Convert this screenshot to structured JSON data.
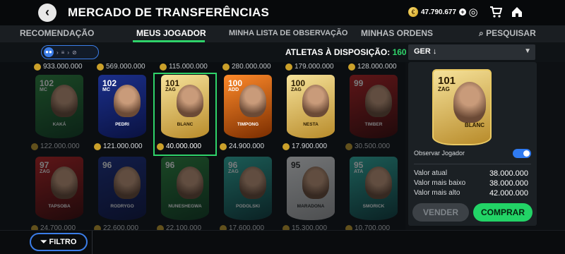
{
  "header": {
    "back_icon": "chevron-left-icon",
    "title": "MERCADO DE TRANSFERÊNCIAS",
    "coins": "47.790.677",
    "coin_symbol": "€",
    "plus": "+"
  },
  "tabs": [
    {
      "label": "RECOMENDAÇÃO",
      "active": false
    },
    {
      "label": "MEUS JOGADOR",
      "active": true
    },
    {
      "label": "MINHA LISTA DE OBSERVAÇÃO",
      "active": false
    },
    {
      "label": "MINHAS ORDENS",
      "active": false
    },
    {
      "label": "PESQUISAR",
      "active": false
    }
  ],
  "filter_row": {
    "athletes_label": "ATLETAS À DISPOSIÇÃO:",
    "athletes_count": "160",
    "sort_value": "GER ↓"
  },
  "top_prices": [
    "933.000.000",
    "569.000.000",
    "115.000.000",
    "280.000.000",
    "179.000.000",
    "128.000.000"
  ],
  "rows": [
    [
      {
        "rating": "102",
        "pos": "MC",
        "name": "KAKÁ",
        "price": "122.000.000",
        "color": "c-green",
        "dim": true
      },
      {
        "rating": "102",
        "pos": "MC",
        "name": "PEDRI",
        "price": "121.000.000",
        "color": "c-blue",
        "dim": false
      },
      {
        "rating": "101",
        "pos": "ZAG",
        "name": "BLANC",
        "price": "40.000.000",
        "color": "c-gold",
        "dim": false,
        "selected": true
      },
      {
        "rating": "100",
        "pos": "ADD",
        "name": "TIMPONG",
        "price": "24.900.000",
        "color": "c-orange",
        "dim": false
      },
      {
        "rating": "100",
        "pos": "ZAG",
        "name": "NESTA",
        "price": "17.900.000",
        "color": "c-gold",
        "dim": false
      },
      {
        "rating": "99",
        "pos": "",
        "name": "TIMBER",
        "price": "30.500.000",
        "color": "c-red",
        "dim": true
      }
    ],
    [
      {
        "rating": "97",
        "pos": "ZAG",
        "name": "TAPSOBA",
        "price": "24.700.000",
        "color": "c-red",
        "dim": true
      },
      {
        "rating": "96",
        "pos": "",
        "name": "RODRYGO",
        "price": "22.600.000",
        "color": "c-blue",
        "dim": true
      },
      {
        "rating": "96",
        "pos": "",
        "name": "NUNESHEGWA",
        "price": "22.100.000",
        "color": "c-green",
        "dim": true
      },
      {
        "rating": "96",
        "pos": "ZAG",
        "name": "PODOLSKI",
        "price": "17.600.000",
        "color": "c-teal",
        "dim": true
      },
      {
        "rating": "95",
        "pos": "",
        "name": "MARADONA",
        "price": "15.300.000",
        "color": "c-white",
        "dim": true
      },
      {
        "rating": "95",
        "pos": "ATA",
        "name": "SMORICK",
        "price": "10.700.000",
        "color": "c-teal",
        "dim": true
      }
    ]
  ],
  "detail": {
    "rating": "101",
    "pos": "ZAG",
    "name": "BLANC",
    "watch_label": "Observar Jogador",
    "values": [
      {
        "label": "Valor atual",
        "value": "38.000.000"
      },
      {
        "label": "Valor mais baixo",
        "value": "38.000.000"
      },
      {
        "label": "Valor mais alto",
        "value": "42.000.000"
      }
    ],
    "sell_label": "VENDER",
    "buy_label": "COMPRAR"
  },
  "bottom": {
    "filter_label": "FILTRO",
    "filter_icon": "funnel-icon"
  },
  "colors": {
    "accent_green": "#2fd36a",
    "accent_blue": "#3b7de8"
  }
}
